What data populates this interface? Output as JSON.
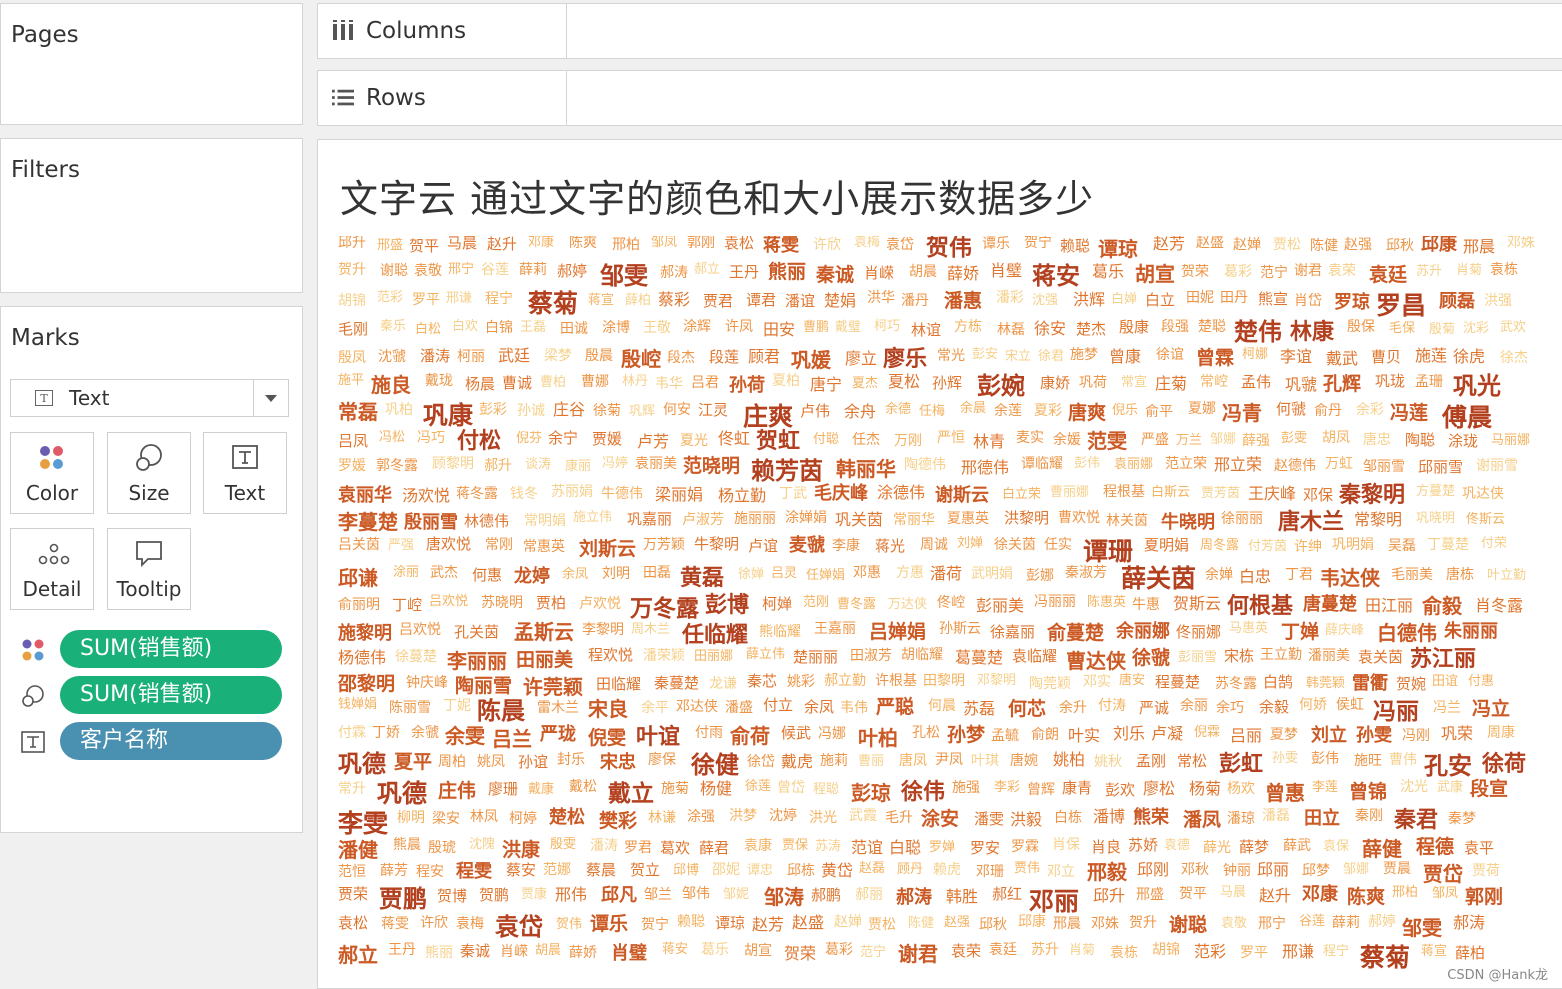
{
  "pages": {
    "title": "Pages"
  },
  "filters": {
    "title": "Filters"
  },
  "columns": {
    "label": "Columns"
  },
  "rows": {
    "label": "Rows"
  },
  "marks": {
    "title": "Marks",
    "mark_type": "Text",
    "buttons": {
      "color": "Color",
      "size": "Size",
      "text": "Text",
      "detail": "Detail",
      "tooltip": "Tooltip"
    },
    "pills": [
      {
        "label": "SUM(销售额)",
        "color": "#1ab07a",
        "icon": "color-icon"
      },
      {
        "label": "SUM(销售额)",
        "color": "#1ab07a",
        "icon": "size-icon"
      },
      {
        "label": "客户名称",
        "color": "#4a90b0",
        "icon": "text-icon"
      }
    ]
  },
  "viz": {
    "title": "文字云 通过文字的颜色和大小展示数据多少",
    "watermark": "CSDN @Hank龙",
    "palette": [
      "#f6d08a",
      "#f4b25f",
      "#ed9545",
      "#e0762e",
      "#cc5a25",
      "#b3401e"
    ]
  },
  "chart_data": {
    "type": "word-cloud",
    "encoding": {
      "text": "客户名称",
      "color": "SUM(销售额)",
      "size": "SUM(销售额)"
    },
    "words": [
      "邱升",
      "邢盛",
      "贺平",
      "马晨",
      "赵升",
      "邓康",
      "陈爽",
      "邢柏",
      "邹凤",
      "郭刚",
      "袁松",
      "蒋雯",
      "许欣",
      "袁梅",
      "袁岱",
      "贺伟",
      "谭乐",
      "贺宁",
      "赖聪",
      "谭琼",
      "赵芳",
      "赵盛",
      "赵婵",
      "贾松",
      "陈健",
      "赵强",
      "邱秋",
      "邱康",
      "邢晨",
      "邓姝",
      "贺升",
      "谢聪",
      "袁敬",
      "邢宁",
      "谷莲",
      "薛莉",
      "郝婷",
      "邹雯",
      "郝涛",
      "郝立",
      "王丹",
      "熊丽",
      "秦诚",
      "肖嵘",
      "胡晨",
      "薛娇",
      "肖璧",
      "蒋安",
      "葛乐",
      "胡宣",
      "贺荣",
      "葛彩",
      "范宁",
      "谢君",
      "袁荣",
      "袁廷",
      "苏升",
      "肖菊",
      "袁栋",
      "胡锦",
      "范彩",
      "罗平",
      "邢谦",
      "程宁",
      "蔡菊",
      "蒋宣",
      "薛柏",
      "蔡彩",
      "贾君",
      "谭君",
      "潘谊",
      "楚娟",
      "洪华",
      "潘丹",
      "潘惠",
      "潘彩",
      "沈强",
      "洪辉",
      "白婵",
      "白立",
      "田妮",
      "田丹",
      "熊宣",
      "肖岱",
      "罗琼",
      "罗昌",
      "顾磊",
      "洪强",
      "毛刚",
      "秦乐",
      "白松",
      "白欢",
      "白锦",
      "王磊",
      "田诚",
      "涂博",
      "王敬",
      "涂辉",
      "许凤",
      "田安",
      "曹鹏",
      "戴璧",
      "柯巧",
      "林谊",
      "方栋",
      "林磊",
      "徐安",
      "楚杰",
      "殷康",
      "段强",
      "楚聪",
      "楚伟",
      "林康",
      "殷保",
      "毛保",
      "殷菊",
      "沈彩",
      "武欢",
      "殷凤",
      "沈虢",
      "潘涛",
      "柯丽",
      "武廷",
      "梁梦",
      "殷晨",
      "殷崆",
      "段杰",
      "段莲",
      "顾君",
      "巩媛",
      "廖立",
      "廖乐",
      "常光",
      "彭安",
      "宋立",
      "徐君",
      "施梦",
      "曾康",
      "徐谊",
      "曾霖",
      "柯娜",
      "李谊",
      "戴武",
      "曹贝",
      "施莲",
      "徐虎",
      "徐杰",
      "施平",
      "施良",
      "戴珑",
      "杨晨",
      "曹诚",
      "曹柏",
      "曹娜",
      "林丹",
      "韦华",
      "吕君",
      "孙荷",
      "夏柏",
      "唐宁",
      "夏杰",
      "夏松",
      "孙辉",
      "彭婉",
      "康娇",
      "巩荷",
      "常宣",
      "庄菊",
      "常崆",
      "孟伟",
      "巩虢",
      "孔辉",
      "巩珑",
      "孟珊",
      "巩光",
      "常磊",
      "巩柏",
      "巩康",
      "彭彩",
      "孙诚",
      "庄谷",
      "徐菊",
      "巩辉",
      "何安",
      "江灵",
      "庄爽",
      "卢伟",
      "余舟",
      "余德",
      "任梅",
      "余晨",
      "余莲",
      "夏彩",
      "唐爽",
      "倪乐",
      "俞平",
      "夏娜",
      "冯青",
      "何虢",
      "俞丹",
      "余彩",
      "冯莲",
      "傅晨",
      "吕凤",
      "冯松",
      "冯巧",
      "付松",
      "倪芬",
      "余宁",
      "贾媛",
      "卢芳",
      "夏光",
      "佟虹",
      "贺虹",
      "付聪",
      "任杰",
      "万刚",
      "严恒",
      "林青",
      "麦实",
      "余媛",
      "范雯",
      "严盛",
      "万兰",
      "邹娜",
      "薛强",
      "彭雯",
      "胡凤",
      "唐忠",
      "陶聪",
      "涂珑",
      "马丽娜",
      "罗媛",
      "郭冬露",
      "顾黎明",
      "郝升",
      "谈涛",
      "康丽",
      "冯婷",
      "袁丽美",
      "范晓明",
      "赖芳茵",
      "韩丽华",
      "陶德伟",
      "邢德伟",
      "谭临耀",
      "彭伟",
      "袁丽娜",
      "范立荣",
      "邢立荣",
      "赵德伟",
      "万虹",
      "邹丽雪",
      "邱丽雪",
      "谢丽雪",
      "袁丽华",
      "汤欢悦",
      "蒋冬露",
      "钱冬",
      "苏丽娟",
      "牛德伟",
      "梁丽娟",
      "杨立勤",
      "丁武",
      "毛庆峰",
      "涂德伟",
      "谢斯云",
      "白立荣",
      "曹丽娜",
      "程根基",
      "白斯云",
      "贾芳茵",
      "王庆峰",
      "邓保",
      "秦黎明",
      "方蔓楚",
      "巩达侠",
      "李蔓楚",
      "殷丽雪",
      "林德伟",
      "常明娟",
      "施立伟",
      "巩嘉丽",
      "卢淑芳",
      "施丽丽",
      "涂婵娟",
      "巩关茵",
      "常丽华",
      "夏惠英",
      "洪黎明",
      "曹欢悦",
      "林关茵",
      "牛晓明",
      "徐丽丽",
      "唐木兰",
      "常黎明",
      "巩晓明",
      "佟斯云",
      "吕关茵",
      "严强",
      "唐欢悦",
      "常刚",
      "常惠英",
      "刘斯云",
      "万芳颖",
      "牛黎明",
      "卢谊",
      "麦虢",
      "李康",
      "蒋光",
      "周诚",
      "刘婵",
      "徐关茵",
      "任实",
      "谭珊",
      "夏明娟",
      "周冬露",
      "付芳茵",
      "许绅",
      "巩明娟",
      "吴磊",
      "丁蔓楚",
      "付荣",
      "邱谦",
      "涂丽",
      "武杰",
      "何惠",
      "龙婷",
      "余凤",
      "刘明",
      "田磊",
      "黄磊",
      "徐婵",
      "吕灵",
      "任婵娟",
      "邓惠",
      "方惠",
      "潘荷",
      "武明娟",
      "彭娜",
      "秦淑芳",
      "薛关茵",
      "余婵",
      "白忠",
      "丁君",
      "韦达侠",
      "毛丽美",
      "唐栋",
      "叶立勤",
      "俞丽明",
      "丁崆",
      "吕欢悦",
      "苏晓明",
      "贾柏",
      "卢欢悦",
      "万冬露",
      "彭博",
      "柯婵",
      "范刚",
      "曹冬露",
      "万达侠",
      "佟崆",
      "彭丽美",
      "冯丽丽",
      "陈惠英",
      "牛惠",
      "贺斯云",
      "何根基",
      "唐蔓楚",
      "田江丽",
      "俞毅",
      "肖冬露",
      "施黎明",
      "吕欢悦",
      "孔关茵",
      "孟斯云",
      "李黎明",
      "周木兰",
      "任临耀",
      "熊临耀",
      "王嘉丽",
      "吕婵娟",
      "孙斯云",
      "徐嘉丽",
      "俞蔓楚",
      "余丽娜",
      "佟丽娜",
      "马惠英",
      "丁婵",
      "薛庆峰",
      "白德伟",
      "朱丽丽",
      "杨德伟",
      "徐蔓楚",
      "李丽丽",
      "田丽美",
      "程欢悦",
      "潘荣颖",
      "田丽娜",
      "薛立伟",
      "楚丽丽",
      "田淑芳",
      "胡临耀",
      "葛蔓楚",
      "袁临耀",
      "曹达侠",
      "徐虢",
      "彭丽雪",
      "宋栋",
      "王立勤",
      "潘丽美",
      "袁关茵",
      "苏江丽",
      "邵黎明",
      "钟庆峰",
      "陶丽雪",
      "许莞颖",
      "田临耀",
      "秦蔓楚",
      "龙谦",
      "秦芯",
      "姚彩",
      "郝立勤",
      "许根基",
      "田黎明",
      "邓黎明",
      "陶莞颖",
      "邓实",
      "唐安",
      "程蔓楚",
      "苏冬露",
      "白鹄",
      "韩莞颖",
      "雷衢",
      "贺婉",
      "田谊",
      "付惠",
      "钱婵娟",
      "陈丽雪",
      "丁妮",
      "陈晨",
      "雷木兰",
      "宋良",
      "余平",
      "邓达侠",
      "潘盛",
      "付立",
      "余凤",
      "韦伟",
      "严聪",
      "何晨",
      "苏磊",
      "何芯",
      "余升",
      "付涛",
      "严诚",
      "余丽",
      "余巧",
      "余毅",
      "何娇",
      "侯虹",
      "冯丽",
      "冯兰",
      "冯立",
      "付霖",
      "丁娇",
      "余虢",
      "余雯",
      "吕兰",
      "严珑",
      "倪雯",
      "叶谊",
      "付雨",
      "俞荷",
      "候武",
      "冯娜",
      "叶柏",
      "孔松",
      "孙梦",
      "孟毓",
      "俞朗",
      "叶实",
      "刘乐",
      "卢凝",
      "倪霖",
      "吕丽",
      "夏梦",
      "刘立",
      "孙雯",
      "冯刚",
      "巩荣",
      "周康",
      "巩德",
      "夏平",
      "周柏",
      "姚凤",
      "孙谊",
      "封乐",
      "宋忠",
      "廖保",
      "徐健",
      "徐岱",
      "戴虎",
      "施莉",
      "曹丽",
      "唐凤",
      "尹凤",
      "叶琪",
      "唐婉",
      "姚柏",
      "姚秋",
      "孟刚",
      "常松",
      "彭虹",
      "孙雯",
      "彭伟",
      "施旺",
      "曹伟",
      "孔安",
      "徐荷",
      "常升",
      "巩德",
      "庄伟",
      "廖珊",
      "戴康",
      "戴松",
      "戴立",
      "施菊",
      "杨健",
      "徐莲",
      "曾岱",
      "程聪",
      "彭琼",
      "徐伟",
      "施强",
      "李彩",
      "曾辉",
      "康青",
      "彭欢",
      "廖松",
      "杨菊",
      "杨欢",
      "曾惠",
      "李莲",
      "曾锦",
      "沈光",
      "武康",
      "段宣",
      "李雯",
      "柳明",
      "梁安",
      "林凤",
      "柯婷",
      "楚松",
      "樊彩",
      "林谦",
      "涂强",
      "洪梦",
      "沈婷",
      "洪光",
      "武霞",
      "毛升",
      "涂安",
      "潘雯",
      "洪毅",
      "白栋",
      "潘博",
      "熊荣",
      "潘凤",
      "潘琼",
      "潘磊",
      "田立",
      "秦刚",
      "秦君",
      "秦梦",
      "潘健",
      "熊晨",
      "殷琥",
      "沈隗",
      "洪康",
      "殷雯",
      "潘涛",
      "罗君",
      "葛欢",
      "薛君",
      "袁康",
      "贾保",
      "苏涛",
      "范谊",
      "白聪",
      "罗婵",
      "罗安",
      "罗霖",
      "肖保",
      "肖良",
      "苏娇",
      "袁德",
      "薛光",
      "薛梦",
      "薛武",
      "袁保",
      "薛健",
      "程德",
      "袁平",
      "范恒",
      "薛芳",
      "程安",
      "程雯",
      "蔡安",
      "范娜",
      "蔡晨",
      "贺立",
      "邱博",
      "邵妮",
      "谭忠",
      "邱栋",
      "黄岱",
      "赵磊",
      "顾丹",
      "赖虎",
      "邓珊",
      "贾伟",
      "邓立",
      "邢毅",
      "邱刚",
      "邓秋",
      "钟丽",
      "邱丽",
      "邱梦",
      "邹娜",
      "贾晨",
      "贾岱",
      "贾荷",
      "贾荣",
      "贾鹏",
      "贺博",
      "贺鹏",
      "贾康",
      "邢伟",
      "邱凡",
      "邹兰",
      "邹伟",
      "邹妮",
      "邹涛",
      "郝鹏",
      "郝丽",
      "郝涛",
      "韩胜",
      "郝红",
      "邓丽"
    ]
  }
}
